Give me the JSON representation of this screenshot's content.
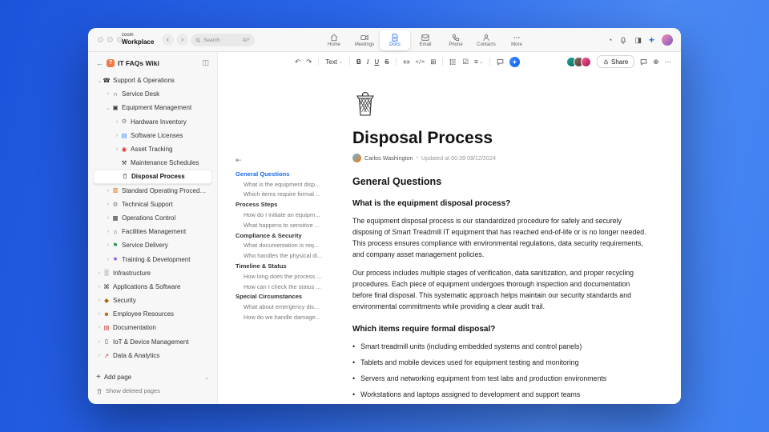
{
  "titlebar": {
    "logo_top": "zoom",
    "logo_bottom": "Workplace",
    "search_placeholder": "Search",
    "search_shortcut": "⌘F",
    "tabs": [
      {
        "label": "Home"
      },
      {
        "label": "Meetings"
      },
      {
        "label": "Docs"
      },
      {
        "label": "Email"
      },
      {
        "label": "Phone"
      },
      {
        "label": "Contacts"
      },
      {
        "label": "More"
      }
    ]
  },
  "sidebar": {
    "title": "IT FAQs Wiki",
    "title_badge": "?",
    "items": [
      {
        "label": "Support & Operations",
        "icon": "☎",
        "chevron": "⌄",
        "level": 0
      },
      {
        "label": "Service Desk",
        "icon": "∩",
        "chevron": "›",
        "level": 1
      },
      {
        "label": "Equipment Management",
        "icon": "▣",
        "chevron": "⌄",
        "level": 1
      },
      {
        "label": "Hardware Inventory",
        "icon": "⚙",
        "chevron": "›",
        "level": 2
      },
      {
        "label": "Software Licenses",
        "icon": "▤",
        "chevron": "›",
        "level": 2
      },
      {
        "label": "Asset Tracking",
        "icon": "◉",
        "chevron": "›",
        "level": 2
      },
      {
        "label": "Maintenance Schedules",
        "icon": "⚒",
        "chevron": "",
        "level": 2
      },
      {
        "label": "Disposal Process",
        "icon": "",
        "chevron": "",
        "level": 2,
        "selected": true
      },
      {
        "label": "Standard Operating Procedures",
        "icon": "▥",
        "chevron": "›",
        "level": 1
      },
      {
        "label": "Technical Support",
        "icon": "⚙",
        "chevron": "›",
        "level": 1
      },
      {
        "label": "Operations Control",
        "icon": "▦",
        "chevron": "›",
        "level": 1
      },
      {
        "label": "Facilities Management",
        "icon": "⌂",
        "chevron": "›",
        "level": 1
      },
      {
        "label": "Service Delivery",
        "icon": "⚑",
        "chevron": "›",
        "level": 1
      },
      {
        "label": "Training & Development",
        "icon": "★",
        "chevron": "›",
        "level": 1
      },
      {
        "label": "Infrastructure",
        "icon": "▒",
        "chevron": "›",
        "level": 0
      },
      {
        "label": "Applications & Software",
        "icon": "⌘",
        "chevron": "›",
        "level": 0
      },
      {
        "label": "Security",
        "icon": "◆",
        "chevron": "›",
        "level": 0
      },
      {
        "label": "Employee Resources",
        "icon": "☻",
        "chevron": "›",
        "level": 0
      },
      {
        "label": "Documentation",
        "icon": "▤",
        "chevron": "›",
        "level": 0
      },
      {
        "label": "IoT & Device Management",
        "icon": "▯",
        "chevron": "›",
        "level": 0
      },
      {
        "label": "Data & Analytics",
        "icon": "↗",
        "chevron": "›",
        "level": 0
      }
    ],
    "add_page_label": "Add page",
    "show_deleted_label": "Show deleted pages"
  },
  "outline": {
    "rows": [
      {
        "label": "General Questions",
        "kind": "section",
        "active": true
      },
      {
        "label": "What is the equipment disp...",
        "kind": "item"
      },
      {
        "label": "Which items require formal ...",
        "kind": "item"
      },
      {
        "label": "Process Steps",
        "kind": "section"
      },
      {
        "label": "How do I initiate an equipm...",
        "kind": "item"
      },
      {
        "label": "What happens to sensitive ...",
        "kind": "item"
      },
      {
        "label": "Compliance & Security",
        "kind": "section"
      },
      {
        "label": "What documentation is req...",
        "kind": "item"
      },
      {
        "label": "Who handles the physical di...",
        "kind": "item"
      },
      {
        "label": "Timeline & Status",
        "kind": "section"
      },
      {
        "label": "How long does the process ...",
        "kind": "item"
      },
      {
        "label": "How can I check the status ...",
        "kind": "item"
      },
      {
        "label": "Special Circumstances",
        "kind": "section"
      },
      {
        "label": "What about emergency dis...",
        "kind": "item"
      },
      {
        "label": "How do we handle damage...",
        "kind": "item"
      }
    ]
  },
  "toolbar": {
    "text_style": "Text",
    "bold": "B",
    "italic": "I",
    "underline": "U",
    "strikethrough": "S",
    "code": "</>",
    "share_label": "Share"
  },
  "icons": {
    "chevron_right": "›",
    "chevron_down": "⌄",
    "back_arrow": "←",
    "sidebar_collapse": "◫",
    "nav_back": "‹",
    "nav_forward": "›",
    "undo": "↶",
    "redo": "↷",
    "caret_down": "⌄",
    "ellipsis": "⋯",
    "outline_collapse": "⇤",
    "plus": "+",
    "history": "◔",
    "panel": "◨",
    "globe": "⊕",
    "checklist": "☑",
    "align": "≡",
    "grid": "⊞"
  },
  "doc": {
    "title": "Disposal Process",
    "author": "Carlos Washington",
    "separator": "•",
    "updated": "Updated at 00:39 09/12/2024",
    "section_heading": "General Questions",
    "q1_heading": "What is the equipment disposal process?",
    "q1_p1": "The equipment disposal process is our standardized procedure for safely and securely disposing of Smart Treadmill IT equipment that has reached end-of-life or is no longer needed. This process ensures compliance with environmental regulations, data security requirements, and company asset management policies.",
    "q1_p2": "Our process includes multiple stages of verification, data sanitization, and proper recycling procedures. Each piece of equipment undergoes thorough inspection and documentation before final disposal. This systematic approach helps maintain our security standards and environmental commitments while providing a clear audit trail.",
    "q2_heading": "Which items require formal disposal?",
    "bullet_glyph": "•",
    "q2_bullets": [
      "Smart treadmill units (including embedded systems and control panels)",
      "Tablets and mobile devices used for equipment testing and monitoring",
      "Servers and networking equipment from test labs and production environments",
      "Workstations and laptops assigned to development and support teams"
    ]
  }
}
